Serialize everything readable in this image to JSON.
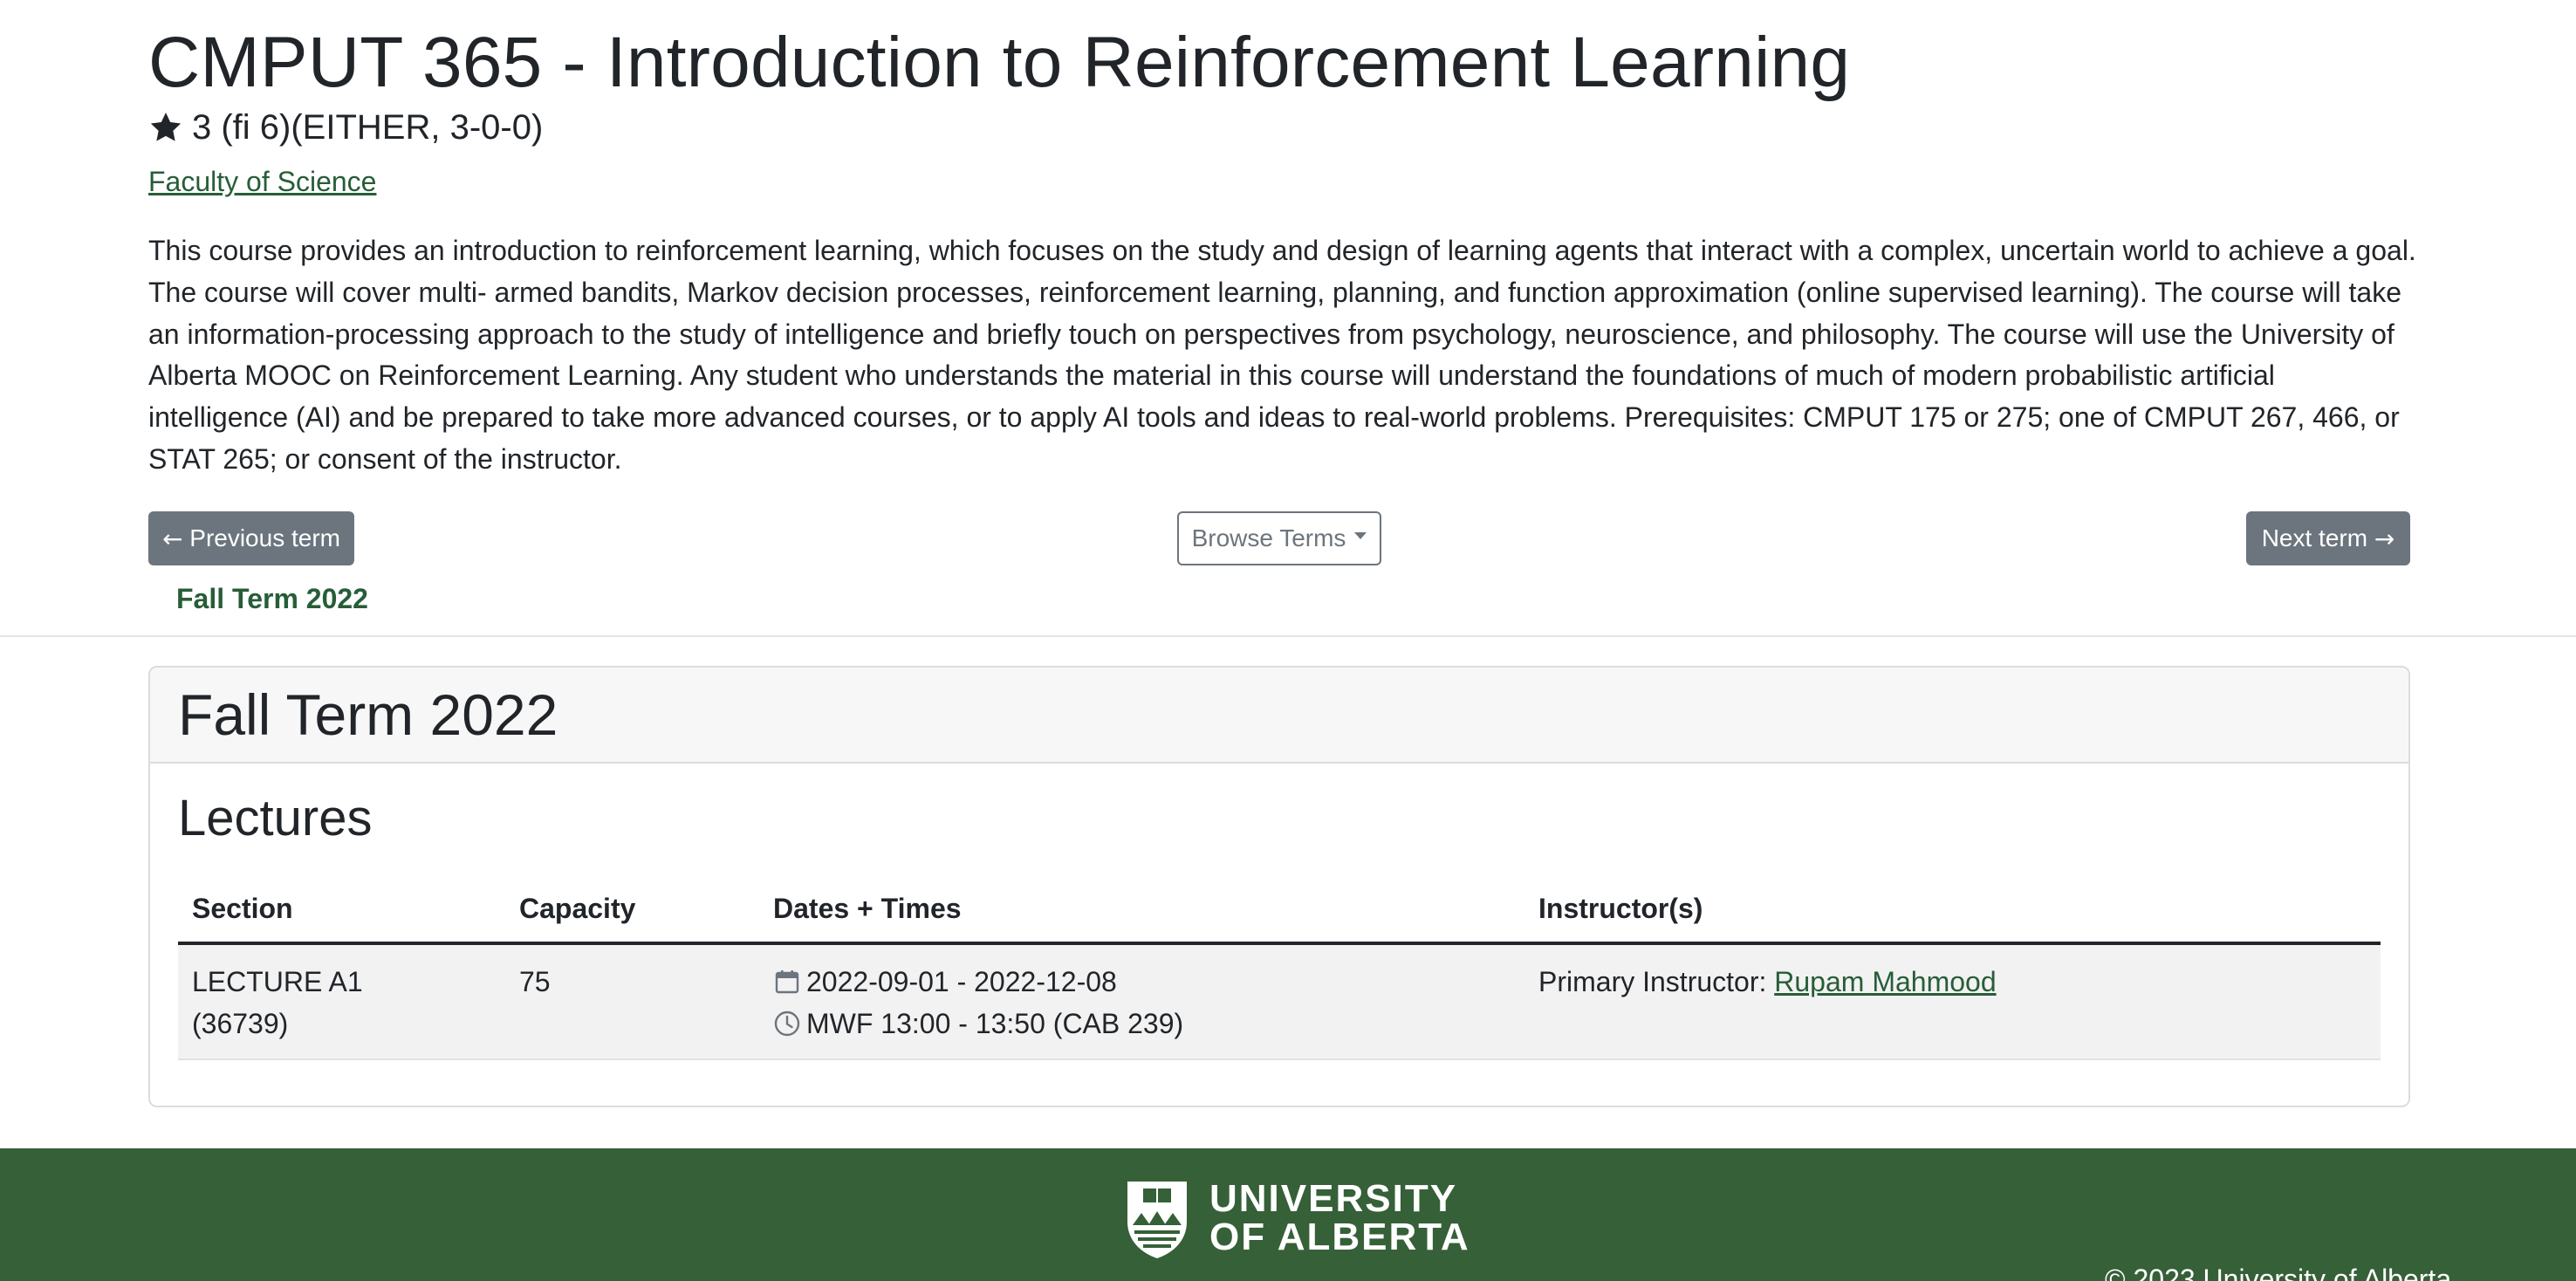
{
  "course": {
    "title": "CMPUT 365 - Introduction to Reinforcement Learning",
    "credits": "3 (fi 6)(EITHER, 3-0-0)",
    "faculty": "Faculty of Science",
    "description": "This course provides an introduction to reinforcement learning, which focuses on the study and design of learning agents that interact with a complex, uncertain world to achieve a goal. The course will cover multi- armed bandits, Markov decision processes, reinforcement learning, planning, and function approximation (online supervised learning). The course will take an information-processing approach to the study of intelligence and briefly touch on perspectives from psychology, neuroscience, and philosophy. The course will use the University of Alberta MOOC on Reinforcement Learning. Any student who understands the material in this course will understand the foundations of much of modern probabilistic artificial intelligence (AI) and be prepared to take more advanced courses, or to apply AI tools and ideas to real-world problems. Prerequisites: CMPUT 175 or 275; one of CMPUT 267, 466, or STAT 265; or consent of the instructor."
  },
  "nav": {
    "prev_label": "Previous term",
    "browse_label": "Browse Terms",
    "next_label": "Next term",
    "prev_arrow": "←",
    "next_arrow": "→",
    "current_tab": "Fall Term 2022"
  },
  "term": {
    "title": "Fall Term 2022",
    "section_title": "Lectures",
    "columns": [
      "Section",
      "Capacity",
      "Dates + Times",
      "Instructor(s)"
    ],
    "rows": [
      {
        "section_line1": "LECTURE A1",
        "section_line2": "(36739)",
        "capacity": "75",
        "dates": "2022-09-01 - 2022-12-08",
        "times": "MWF 13:00 - 13:50 (CAB 239)",
        "instructor_prefix": "Primary Instructor:",
        "instructor_name": "Rupam Mahmood"
      }
    ]
  },
  "footer": {
    "logo_line1": "UNIVERSITY",
    "logo_line2": "OF ALBERTA",
    "copyright": "© 2023 University of Alberta"
  },
  "colors": {
    "brand_green": "#275d38",
    "footer_green": "#366038",
    "button_gray": "#6c757d"
  },
  "icons": [
    "star-icon",
    "arrow-left-icon",
    "caret-down-icon",
    "arrow-right-icon",
    "calendar-icon",
    "clock-icon",
    "university-crest-icon"
  ]
}
